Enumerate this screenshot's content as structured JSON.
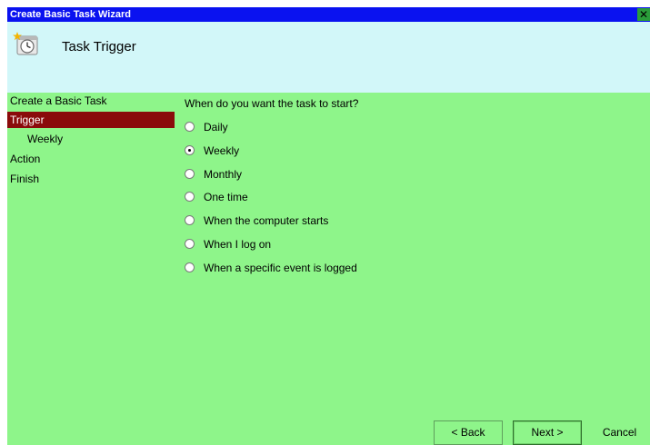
{
  "window": {
    "title": "Create Basic Task Wizard",
    "close_glyph": "✕"
  },
  "header": {
    "title": "Task Trigger",
    "icon": "clock-icon"
  },
  "sidebar": {
    "items": [
      {
        "label": "Create a Basic Task",
        "selected": false,
        "sub": false
      },
      {
        "label": "Trigger",
        "selected": true,
        "sub": false
      },
      {
        "label": "Weekly",
        "selected": false,
        "sub": true
      },
      {
        "label": "Action",
        "selected": false,
        "sub": false
      },
      {
        "label": "Finish",
        "selected": false,
        "sub": false
      }
    ]
  },
  "main": {
    "question": "When do you want the task to start?",
    "options": [
      {
        "label": "Daily",
        "checked": false
      },
      {
        "label": "Weekly",
        "checked": true
      },
      {
        "label": "Monthly",
        "checked": false
      },
      {
        "label": "One time",
        "checked": false
      },
      {
        "label": "When the computer starts",
        "checked": false
      },
      {
        "label": "When I log on",
        "checked": false
      },
      {
        "label": "When a specific event is logged",
        "checked": false
      }
    ]
  },
  "buttons": {
    "back": "< Back",
    "next": "Next >",
    "cancel": "Cancel"
  },
  "colors": {
    "titlebar": "#0a12f0",
    "header_bg": "#d2f7f9",
    "body_bg": "#8ef58a",
    "selected_bg": "#8a0b0b"
  }
}
